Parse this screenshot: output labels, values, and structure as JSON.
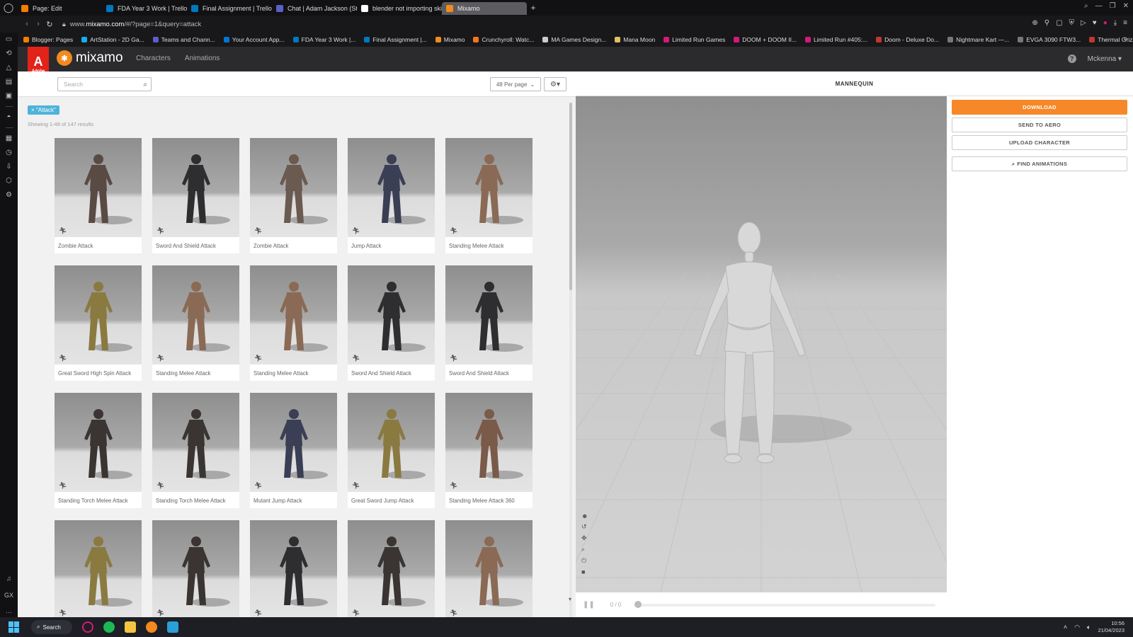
{
  "browser": {
    "tabs": [
      {
        "label": "Page: Edit",
        "color": "#f57d00"
      },
      {
        "label": "FDA Year 3 Work | Trello",
        "color": "#0079bf"
      },
      {
        "label": "Final Assignment | Trello",
        "color": "#0079bf"
      },
      {
        "label": "Chat | Adam Jackson (St",
        "color": "#5b5fc7"
      },
      {
        "label": "blender not importing ski",
        "color": "#ffffff"
      },
      {
        "label": "Mixamo",
        "color": "#f28a1f"
      }
    ],
    "new_tab": "+",
    "url_prefix": "www.",
    "url_domain": "mixamo.com",
    "url_path": "/#/?page=1&query=attack",
    "bookmarks": [
      {
        "label": "Blogger: Pages",
        "color": "#f57d00"
      },
      {
        "label": "ArtStation - 2D Ga...",
        "color": "#13aff0"
      },
      {
        "label": "Teams and Chann...",
        "color": "#5b5fc7"
      },
      {
        "label": "Your Account App...",
        "color": "#0078d4"
      },
      {
        "label": "FDA Year 3 Work |...",
        "color": "#0079bf"
      },
      {
        "label": "Final Assignment |...",
        "color": "#0079bf"
      },
      {
        "label": "Mixamo",
        "color": "#f28a1f"
      },
      {
        "label": "Crunchyroll: Watc...",
        "color": "#f47521"
      },
      {
        "label": "MA Games Design...",
        "color": "#cccccc"
      },
      {
        "label": "Mana Moon",
        "color": "#e0c060"
      },
      {
        "label": "Limited Run Games",
        "color": "#d4197a"
      },
      {
        "label": "DOOM + DOOM II...",
        "color": "#d4197a"
      },
      {
        "label": "Limited Run #405:...",
        "color": "#d4197a"
      },
      {
        "label": "Doom - Deluxe Do...",
        "color": "#c0392b"
      },
      {
        "label": "Nightmare Kart —...",
        "color": "#777777"
      },
      {
        "label": "EVGA 3090 FTW3...",
        "color": "#777777"
      },
      {
        "label": "Thermal Grizzly D...",
        "color": "#c0392b"
      }
    ]
  },
  "mixamo": {
    "adobe_badge": "Adobe",
    "logo_text": "mixamo",
    "nav": [
      "Characters",
      "Animations"
    ],
    "help": "?",
    "user": "Mckenna"
  },
  "search": {
    "placeholder": "Search"
  },
  "per_page": "48 Per page",
  "filter_tag": "× \"Attack\"",
  "results_text": "Showing 1-48 of 147 results",
  "animations": [
    "Zombie Attack",
    "Sword And Shield Attack",
    "Zombie Attack",
    "Jump Attack",
    "Standing Melee Attack",
    "Great Sword High Spin Attack",
    "Standing Melee Attack",
    "Standing Melee Attack",
    "Sword And Shield Attack",
    "Sword And Shield Attack",
    "Standing Torch Melee Attack",
    "Standing Torch Melee Attack",
    "Mutant Jump Attack",
    "Great Sword Jump Attack",
    "Standing Melee Attack 360",
    "",
    "",
    "",
    "",
    ""
  ],
  "character_colors": [
    "#5a4a44",
    "#2e2e30",
    "#6a5a50",
    "#3a3f55",
    "#8a6a55",
    "#8a7a40",
    "#8a6a55",
    "#8a6a55",
    "#2e2e30",
    "#2e2e30",
    "#3a3432",
    "#3a3432",
    "#3a3f55",
    "#8a7a40",
    "#7a5a48",
    "#8a7a40",
    "#3a3432",
    "#2e2e30",
    "#3a3432",
    "#8a6a55"
  ],
  "viewer": {
    "title": "MANNEQUIN",
    "frame_counter": "0 / 0",
    "buttons": {
      "download": "DOWNLOAD",
      "send_to_aero": "SEND TO AERO",
      "upload_character": "UPLOAD CHARACTER",
      "find_animations": "FIND ANIMATIONS"
    }
  },
  "taskbar": {
    "search_label": "Search",
    "time": "10:56",
    "date": "21/04/2023"
  }
}
